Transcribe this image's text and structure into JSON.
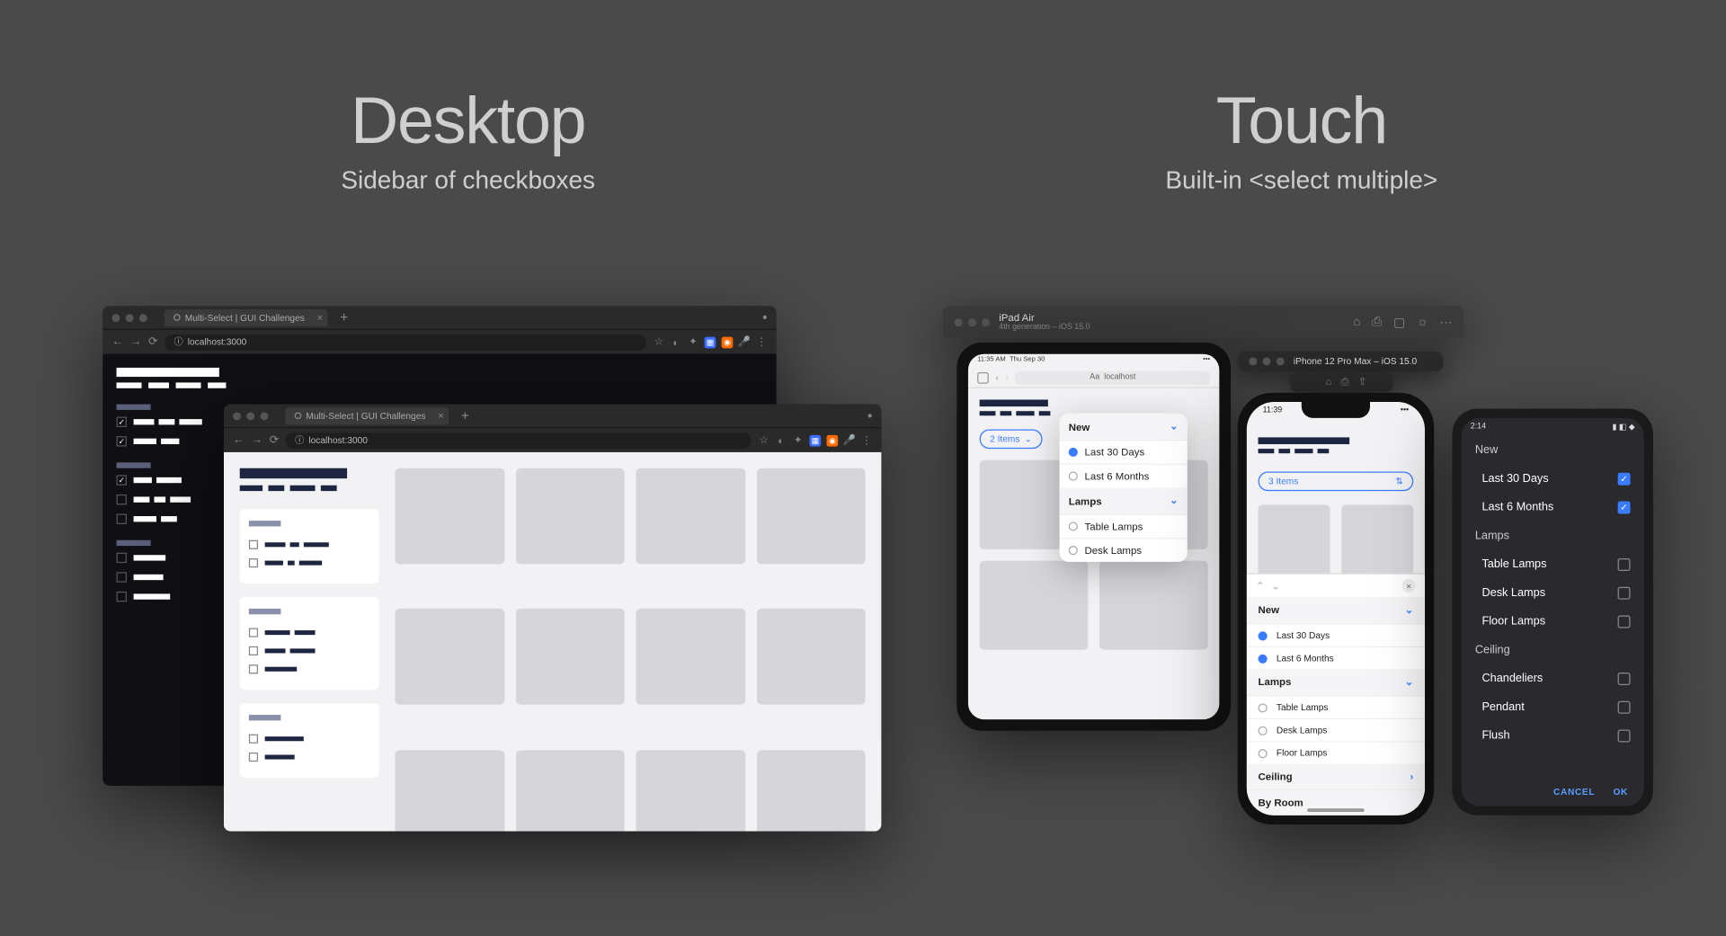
{
  "desktop": {
    "title": "Desktop",
    "subtitle": "Sidebar of checkboxes"
  },
  "touch": {
    "title": "Touch",
    "subtitle": "Built-in <select multiple>"
  },
  "browser": {
    "tab_title": "Multi-Select | GUI Challenges",
    "url": "localhost:3000"
  },
  "simulator_ipad": {
    "device": "iPad Air",
    "detail": "4th generation – iOS 15.0"
  },
  "simulator_iphone": {
    "title": "iPhone 12 Pro Max – iOS 15.0"
  },
  "ipad": {
    "time": "11:35 AM",
    "date": "Thu Sep 30",
    "url_short": "localhost",
    "pill": "2 Items"
  },
  "iphone": {
    "time": "11:39",
    "pill": "3 Items"
  },
  "android": {
    "time": "2:14",
    "groups": [
      {
        "label": "New",
        "options": [
          {
            "label": "Last 30 Days",
            "checked": true
          },
          {
            "label": "Last 6 Months",
            "checked": true
          }
        ]
      },
      {
        "label": "Lamps",
        "options": [
          {
            "label": "Table Lamps",
            "checked": false
          },
          {
            "label": "Desk Lamps",
            "checked": false
          },
          {
            "label": "Floor Lamps",
            "checked": false
          }
        ]
      },
      {
        "label": "Ceiling",
        "options": [
          {
            "label": "Chandeliers",
            "checked": false
          },
          {
            "label": "Pendant",
            "checked": false
          },
          {
            "label": "Flush",
            "checked": false
          }
        ]
      }
    ],
    "actions": {
      "cancel": "CANCEL",
      "ok": "OK"
    }
  },
  "ios_popover": {
    "groups": [
      {
        "label": "New",
        "options": [
          {
            "label": "Last 30 Days",
            "selected": true
          },
          {
            "label": "Last 6 Months",
            "selected": false
          }
        ]
      },
      {
        "label": "Lamps",
        "options": [
          {
            "label": "Table Lamps",
            "selected": false
          },
          {
            "label": "Desk Lamps",
            "selected": false
          }
        ]
      }
    ]
  },
  "iphone_sheet": {
    "groups": [
      {
        "label": "New",
        "expanded": true,
        "options": [
          {
            "label": "Last 30 Days",
            "selected": true
          },
          {
            "label": "Last 6 Months",
            "selected": true
          }
        ]
      },
      {
        "label": "Lamps",
        "expanded": true,
        "options": [
          {
            "label": "Table Lamps",
            "selected": false
          },
          {
            "label": "Desk Lamps",
            "selected": false
          },
          {
            "label": "Floor Lamps",
            "selected": false
          }
        ]
      },
      {
        "label": "Ceiling",
        "expanded": false,
        "chevron": "right",
        "options": []
      },
      {
        "label": "By Room",
        "expanded": false,
        "chevron": "none",
        "options": []
      }
    ]
  }
}
